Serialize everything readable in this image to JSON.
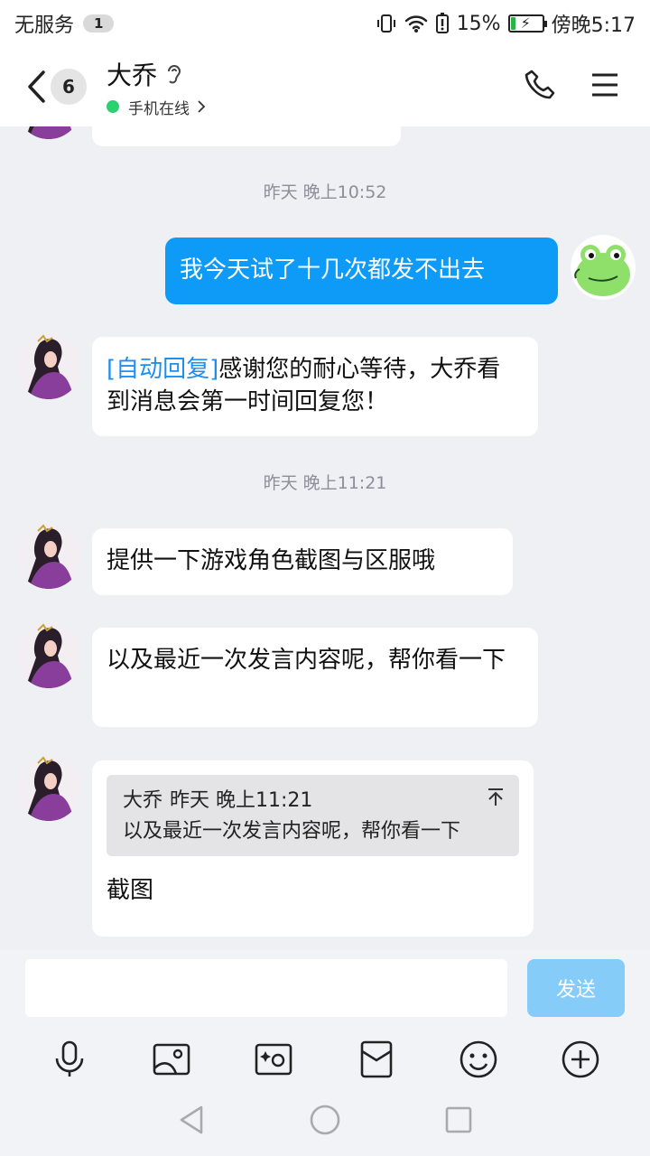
{
  "status_bar": {
    "carrier": "无服务",
    "sim_badge": "1",
    "battery_percent": "15%",
    "battery_level": 0.15,
    "time": "傍晚5:17"
  },
  "header": {
    "unread_count": "6",
    "contact_name": "大乔",
    "status": "手机在线",
    "status_color": "#2bd070",
    "icons": [
      "back-icon",
      "ear-icon",
      "phone-icon",
      "menu-icon"
    ]
  },
  "chat": {
    "timestamps": [
      "昨天 晚上10:52",
      "昨天 晚上11:21"
    ],
    "messages": [
      {
        "sender": "me",
        "text": "我今天试了十几次都发不出去"
      },
      {
        "sender": "them",
        "tag": "[自动回复]",
        "text": "感谢您的耐心等待，大乔看到消息会第一时间回复您！"
      },
      {
        "sender": "them",
        "text": "提供一下游戏角色截图与区服哦"
      },
      {
        "sender": "them",
        "text": "以及最近一次发言内容呢，帮你看一下"
      },
      {
        "sender": "them",
        "quote": {
          "author": "大乔",
          "time": "昨天 晚上11:21",
          "text": "以及最近一次发言内容呢，帮你看一下"
        },
        "text": "截图"
      }
    ]
  },
  "input": {
    "value": "",
    "send_label": "发送",
    "send_color": "#86ccf9"
  },
  "toolbar": {
    "icons": [
      "microphone-icon",
      "picture-icon",
      "camera-icon",
      "red-packet-icon",
      "emoji-icon",
      "plus-icon"
    ]
  },
  "colors": {
    "my_bubble": "#0d9bf7",
    "auto_reply_tag": "#1f8ef1",
    "chat_background": "#eef0f4"
  }
}
